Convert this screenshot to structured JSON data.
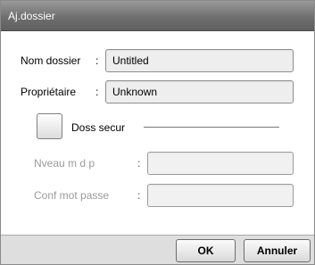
{
  "dialog": {
    "title": "Aj.dossier",
    "fields": {
      "folder_name": {
        "label": "Nom dossier",
        "colon": ":",
        "value": "Untitled"
      },
      "owner": {
        "label": "Propriétaire",
        "colon": ":",
        "value": "Unknown"
      }
    },
    "secure": {
      "label": "Doss secur",
      "checked": false
    },
    "password": {
      "level_label": "Nveau m d p",
      "level_colon": ":",
      "level_value": "",
      "confirm_label": "Conf mot passe",
      "confirm_colon": ":",
      "confirm_value": ""
    },
    "buttons": {
      "ok": "OK",
      "cancel": "Annuler"
    }
  }
}
